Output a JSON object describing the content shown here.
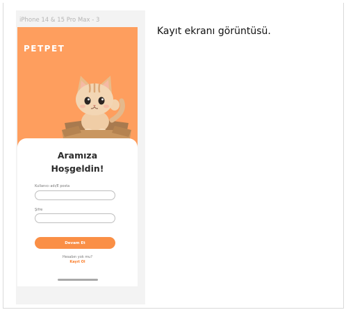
{
  "frame": {
    "label": "iPhone 14 & 15 Pro Max - 3"
  },
  "app": {
    "brand": "PETPET",
    "welcome_line1": "Aramıza",
    "welcome_line2": "Hoşgeldin!",
    "username_label": "Kullanıcı adı/E posta",
    "password_label": "Şifre",
    "continue_label": "Devam Et",
    "no_account_text": "Hesabın yok mu?",
    "register_label": "Kayıt Ol"
  },
  "caption": "Kayıt ekranı görüntüsü.",
  "colors": {
    "accent": "#fe9e5e",
    "button": "#fa8f46",
    "link": "#fa7d2a"
  }
}
